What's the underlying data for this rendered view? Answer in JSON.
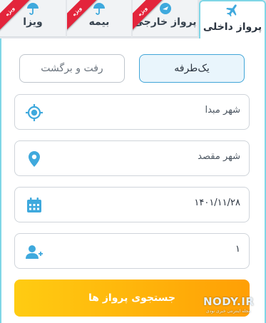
{
  "tabs": [
    {
      "label": "پرواز داخلی",
      "icon": "airplane-icon",
      "ribbon": ""
    },
    {
      "label": "پرواز خارجی",
      "icon": "globe-plane-icon",
      "ribbon": "ویژه"
    },
    {
      "label": "بیمه",
      "icon": "umbrella-icon",
      "ribbon": "ویژه"
    },
    {
      "label": "ویزا",
      "icon": "umbrella-icon",
      "ribbon": "ویژه"
    }
  ],
  "trip_type": {
    "one_way": "یک‌طرفه",
    "round_trip": "رفت و برگشت"
  },
  "fields": {
    "origin": "شهر مبدا",
    "destination": "شهر مقصد",
    "date": "۱۴۰۱/۱۱/۲۸",
    "passengers": "۱"
  },
  "search_button": "جستجوی پرواز ها",
  "watermark": {
    "main": "NODY.IR",
    "sub": "مجله اینترنتی خبری نودی"
  },
  "colors": {
    "accent": "#41a6d8",
    "ribbon": "#e3243b",
    "button": "#ffbb0d",
    "icon": "#3fa9dd"
  }
}
